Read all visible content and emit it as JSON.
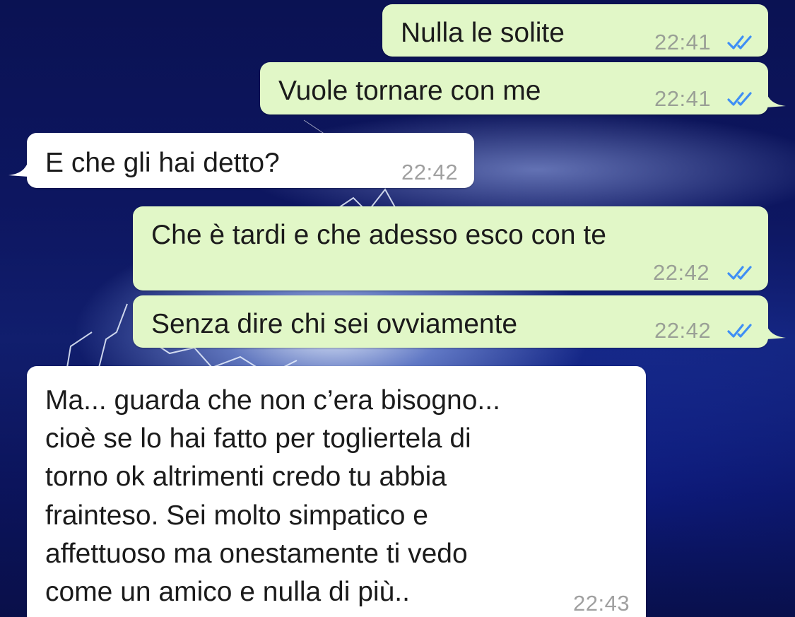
{
  "chat": {
    "messages": [
      {
        "direction": "outgoing",
        "text": "Nulla le solite",
        "time": "22:41",
        "status_icon": "double-check-read-icon"
      },
      {
        "direction": "outgoing",
        "text": "Vuole tornare con me",
        "time": "22:41",
        "status_icon": "double-check-read-icon"
      },
      {
        "direction": "incoming",
        "text": "E che gli hai detto?",
        "time": "22:42"
      },
      {
        "direction": "outgoing",
        "text": "Che è tardi e che adesso esco con te",
        "time": "22:42",
        "status_icon": "double-check-read-icon"
      },
      {
        "direction": "outgoing",
        "text": "Senza dire chi sei ovviamente",
        "time": "22:42",
        "status_icon": "double-check-read-icon"
      },
      {
        "direction": "incoming",
        "text_lines": [
          "Ma... guarda che non c’era bisogno...",
          "cioè se lo hai fatto per togliertela di",
          "torno ok altrimenti credo tu abbia",
          "frainteso. Sei molto simpatico e",
          "affettuoso ma onestamente ti vedo",
          "come un amico e nulla di più.."
        ],
        "time": "22:43"
      }
    ]
  },
  "colors": {
    "outgoing_bubble": "#e1f7c7",
    "incoming_bubble": "#ffffff",
    "read_ticks": "#3f8ff5",
    "timestamp": "#9aa096",
    "background": "#12228a"
  }
}
